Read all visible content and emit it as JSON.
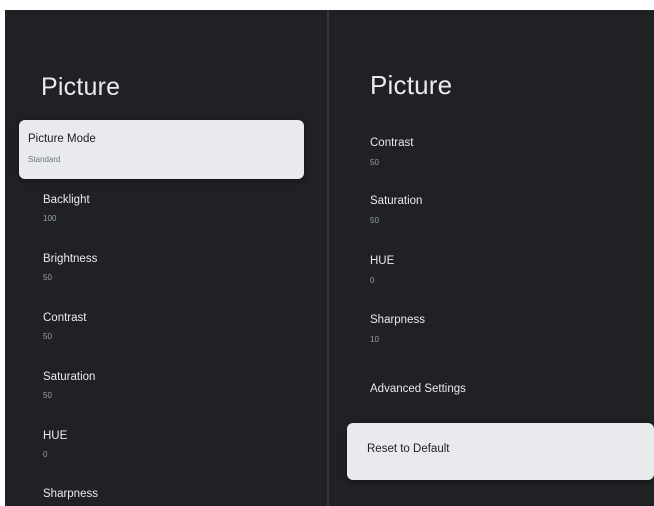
{
  "left_panel": {
    "title": "Picture",
    "items": [
      {
        "label": "Picture Mode",
        "value": "Standard"
      },
      {
        "label": "Backlight",
        "value": "100"
      },
      {
        "label": "Brightness",
        "value": "50"
      },
      {
        "label": "Contrast",
        "value": "50"
      },
      {
        "label": "Saturation",
        "value": "50"
      },
      {
        "label": "HUE",
        "value": "0"
      },
      {
        "label": "Sharpness",
        "value": ""
      }
    ]
  },
  "right_panel": {
    "title": "Picture",
    "items": [
      {
        "label": "Contrast",
        "value": "50"
      },
      {
        "label": "Saturation",
        "value": "50"
      },
      {
        "label": "HUE",
        "value": "0"
      },
      {
        "label": "Sharpness",
        "value": "10"
      },
      {
        "label": "Advanced Settings",
        "value": ""
      },
      {
        "label": "Reset to Default",
        "value": ""
      }
    ]
  },
  "colors": {
    "background": "#202124",
    "focused_item": "#e8eaed",
    "text_primary": "#e8eaed",
    "text_secondary": "#9aa0a6"
  }
}
